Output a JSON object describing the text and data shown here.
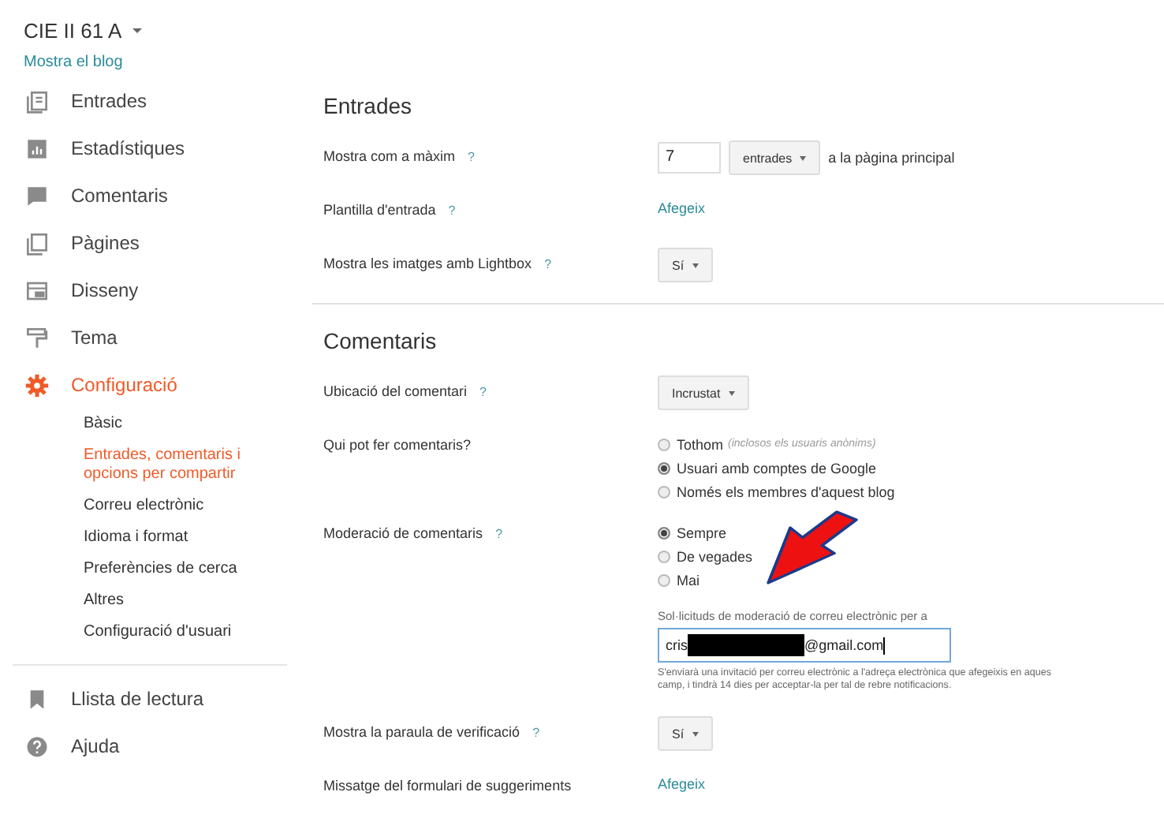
{
  "blog": {
    "title": "CIE II 61 A",
    "view_link": "Mostra el blog"
  },
  "sidebar": {
    "items": [
      {
        "label": "Entrades",
        "selected": false
      },
      {
        "label": "Estadístiques",
        "selected": false
      },
      {
        "label": "Comentaris",
        "selected": false
      },
      {
        "label": "Pàgines",
        "selected": false
      },
      {
        "label": "Disseny",
        "selected": false
      },
      {
        "label": "Tema",
        "selected": false
      },
      {
        "label": "Configuració",
        "selected": true,
        "children": [
          {
            "label": "Bàsic",
            "selected": false
          },
          {
            "label": "Entrades, comentaris i opcions per compartir",
            "selected": true
          },
          {
            "label": "Correu electrònic",
            "selected": false
          },
          {
            "label": "Idioma i format",
            "selected": false
          },
          {
            "label": "Preferències de cerca",
            "selected": false
          },
          {
            "label": "Altres",
            "selected": false
          },
          {
            "label": "Configuració d'usuari",
            "selected": false
          }
        ]
      }
    ],
    "footer_items": [
      {
        "label": "Llista de lectura"
      },
      {
        "label": "Ajuda"
      }
    ]
  },
  "sections": [
    {
      "title": "Entrades",
      "rows": [
        {
          "label": "Mostra com a màxim",
          "help": "?",
          "controls": [
            {
              "kind": "number",
              "value": "7"
            },
            {
              "kind": "select",
              "value": "entrades"
            },
            {
              "kind": "text",
              "text": "a la pàgina principal"
            }
          ]
        },
        {
          "label": "Plantilla d'entrada",
          "help": "?",
          "controls": [
            {
              "kind": "link",
              "text": "Afegeix"
            }
          ]
        },
        {
          "label": "Mostra les imatges amb Lightbox",
          "help": "?",
          "controls": [
            {
              "kind": "select",
              "value": "Sí"
            }
          ]
        }
      ]
    },
    {
      "title": "Comentaris",
      "rows": [
        {
          "label": "Ubicació del comentari",
          "help": "?",
          "controls": [
            {
              "kind": "select",
              "value": "Incrustat"
            }
          ]
        },
        {
          "label": "Qui pot fer comentaris?",
          "controls": [
            {
              "kind": "radios",
              "options": [
                {
                  "label": "Tothom",
                  "note": "(inclosos els usuaris anònims)",
                  "selected": false
                },
                {
                  "label": "Usuari amb comptes de Google",
                  "selected": true
                },
                {
                  "label": "Només els membres d'aquest blog",
                  "selected": false
                }
              ]
            }
          ]
        },
        {
          "label": "Moderació de comentaris",
          "help": "?",
          "controls": [
            {
              "kind": "radios",
              "options": [
                {
                  "label": "Sempre",
                  "selected": true
                },
                {
                  "label": "De vegades",
                  "selected": false
                },
                {
                  "label": "Mai",
                  "selected": false
                }
              ]
            },
            {
              "kind": "email",
              "label": "Sol·licituds de moderació de correu electrònic per a",
              "prefix": "cris",
              "suffix": "@gmail.com",
              "hint_lines": [
                "S'enviarà una invitació per correu electrònic a l'adreça electrònica que afegeixis en aques",
                "camp, i tindrà 14 dies per acceptar-la per tal de rebre notificacions."
              ]
            }
          ]
        },
        {
          "label": "Mostra la paraula de verificació",
          "help": "?",
          "controls": [
            {
              "kind": "select",
              "value": "Sí"
            }
          ]
        },
        {
          "label": "Missatge del formulari de suggeriments",
          "controls": [
            {
              "kind": "link",
              "text": "Afegeix"
            }
          ]
        }
      ]
    }
  ]
}
